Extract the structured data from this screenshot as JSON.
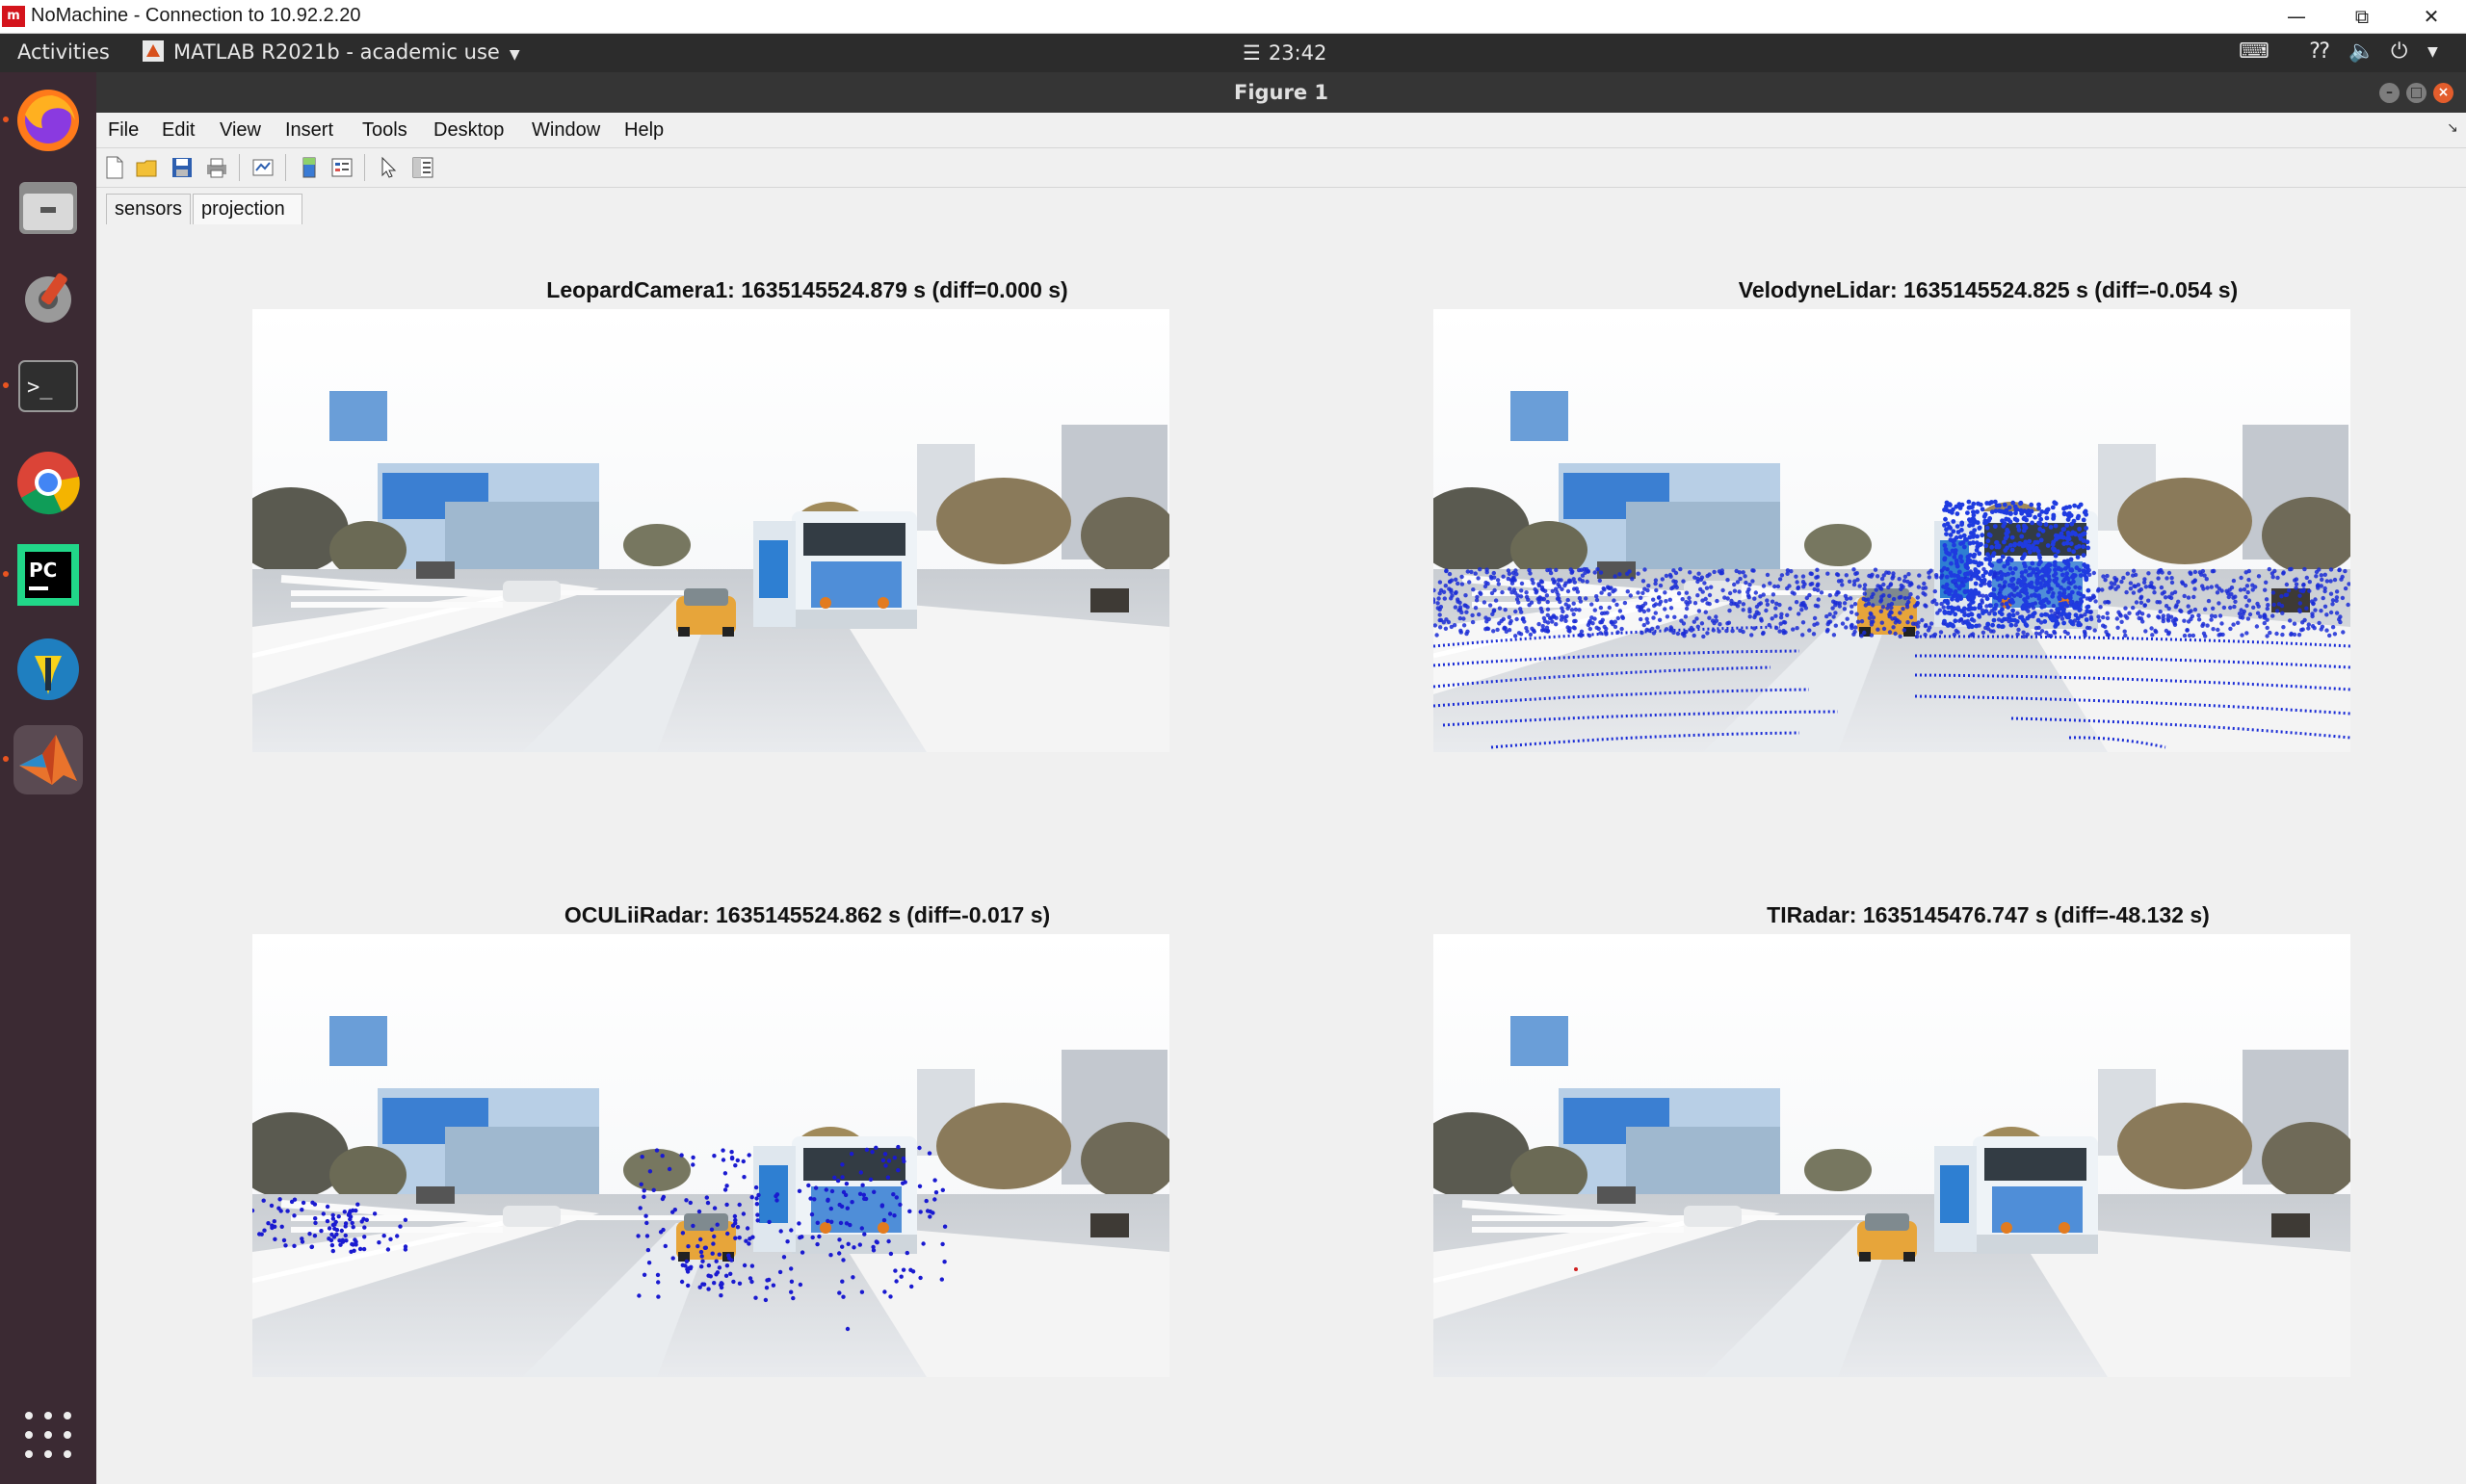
{
  "nomachine": {
    "logo": "m",
    "title": "NoMachine - Connection to 10.92.2.20",
    "controls": [
      "minimize-icon",
      "restore-icon",
      "close-icon"
    ]
  },
  "topbar": {
    "activities": "Activities",
    "app_name": "MATLAB R2021b - academic use",
    "clock": "23:42"
  },
  "figure_window": {
    "title": "Figure 1"
  },
  "dock": {
    "apps": [
      "firefox-icon",
      "files-icon",
      "settings-icon",
      "terminal-icon",
      "chrome-icon",
      "pycharm-icon",
      "app-icon",
      "matlab-icon"
    ],
    "pycharm_label": "PC",
    "terminal_label": ">_"
  },
  "menu": [
    "File",
    "Edit",
    "View",
    "Insert",
    "Tools",
    "Desktop",
    "Window",
    "Help"
  ],
  "tabs": [
    "sensors",
    "projection"
  ],
  "panels": [
    {
      "title": "LeopardCamera1: 1635145524.879 s (diff=0.000 s)",
      "overlay": "none"
    },
    {
      "title": "VelodyneLidar: 1635145524.825 s (diff=-0.054 s)",
      "overlay": "lidar-points"
    },
    {
      "title": "OCULiiRadar: 1635145524.862 s (diff=-0.017 s)",
      "overlay": "radar-points"
    },
    {
      "title": "TIRadar: 1635145476.747 s (diff=-48.132 s)",
      "overlay": "sparse-points"
    }
  ],
  "colors": {
    "dock_bg": "#3b2a33",
    "topbar_bg": "#2c2c2c",
    "figure_bg": "#f0f0f0",
    "point_blue": "#1a2cd6",
    "accent_orange": "#e95420"
  }
}
